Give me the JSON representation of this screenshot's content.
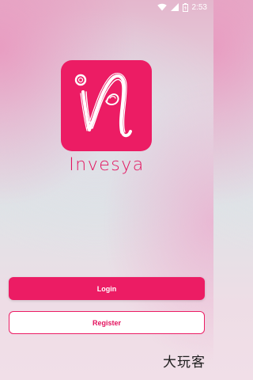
{
  "status_bar": {
    "time": "2:53",
    "icons": [
      "wifi-icon",
      "signal-icon",
      "battery-icon"
    ]
  },
  "app": {
    "name": "Invesya",
    "logo": "invesya-logo"
  },
  "buttons": {
    "login_label": "Login",
    "register_label": "Register"
  },
  "watermark": "大玩客",
  "colors": {
    "brand": "#ec1c64",
    "brand_text": "#e3125e",
    "button_text_light": "#ffffff"
  }
}
